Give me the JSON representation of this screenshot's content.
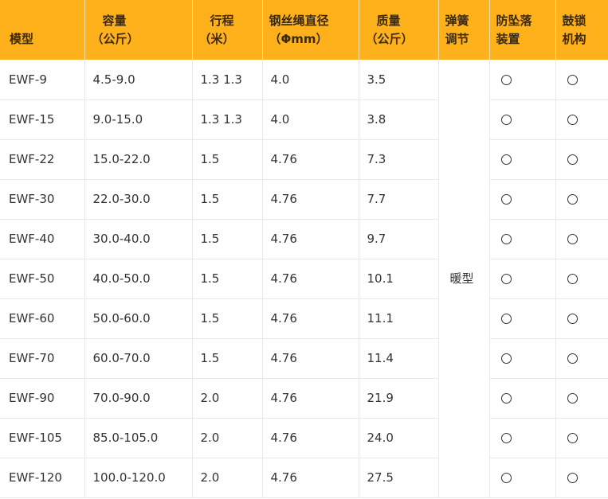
{
  "header": {
    "model": "模型",
    "capacity_line1": "容量",
    "capacity_line2": "（公斤）",
    "stroke_line1": "行程",
    "stroke_line2": "（米）",
    "wire_line1": "钢丝绳直径",
    "wire_line2": "（Φmm）",
    "mass_line1": "质量",
    "mass_line2": "（公斤）",
    "spring_line1": "弹簧",
    "spring_line2": "调节",
    "anti_fall_line1": "防坠落",
    "anti_fall_line2": "装置",
    "drum_lock_line1": "鼓锁",
    "drum_lock_line2": "机构"
  },
  "spring_adjustment_value": "暖型",
  "rows": [
    {
      "model": "EWF-9",
      "capacity": "4.5-9.0",
      "stroke": "1.3 1.3",
      "wire": "4.0",
      "mass": "3.5",
      "anti_fall": "○",
      "drum_lock": "○"
    },
    {
      "model": "EWF-15",
      "capacity": "9.0-15.0",
      "stroke": "1.3 1.3",
      "wire": "4.0",
      "mass": "3.8",
      "anti_fall": "○",
      "drum_lock": "○"
    },
    {
      "model": "EWF-22",
      "capacity": "15.0-22.0",
      "stroke": "1.5",
      "wire": "4.76",
      "mass": "7.3",
      "anti_fall": "○",
      "drum_lock": "○"
    },
    {
      "model": "EWF-30",
      "capacity": "22.0-30.0",
      "stroke": "1.5",
      "wire": "4.76",
      "mass": "7.7",
      "anti_fall": "○",
      "drum_lock": "○"
    },
    {
      "model": "EWF-40",
      "capacity": "30.0-40.0",
      "stroke": "1.5",
      "wire": "4.76",
      "mass": "9.7",
      "anti_fall": "○",
      "drum_lock": "○"
    },
    {
      "model": "EWF-50",
      "capacity": "40.0-50.0",
      "stroke": "1.5",
      "wire": "4.76",
      "mass": "10.1",
      "anti_fall": "○",
      "drum_lock": "○"
    },
    {
      "model": "EWF-60",
      "capacity": "50.0-60.0",
      "stroke": "1.5",
      "wire": "4.76",
      "mass": "11.1",
      "anti_fall": "○",
      "drum_lock": "○"
    },
    {
      "model": "EWF-70",
      "capacity": "60.0-70.0",
      "stroke": "1.5",
      "wire": "4.76",
      "mass": "11.4",
      "anti_fall": "○",
      "drum_lock": "○"
    },
    {
      "model": "EWF-90",
      "capacity": "70.0-90.0",
      "stroke": "2.0",
      "wire": "4.76",
      "mass": "21.9",
      "anti_fall": "○",
      "drum_lock": "○"
    },
    {
      "model": "EWF-105",
      "capacity": "85.0-105.0",
      "stroke": "2.0",
      "wire": "4.76",
      "mass": "24.0",
      "anti_fall": "○",
      "drum_lock": "○"
    },
    {
      "model": "EWF-120",
      "capacity": "100.0-120.0",
      "stroke": "2.0",
      "wire": "4.76",
      "mass": "27.5",
      "anti_fall": "○",
      "drum_lock": "○"
    }
  ]
}
